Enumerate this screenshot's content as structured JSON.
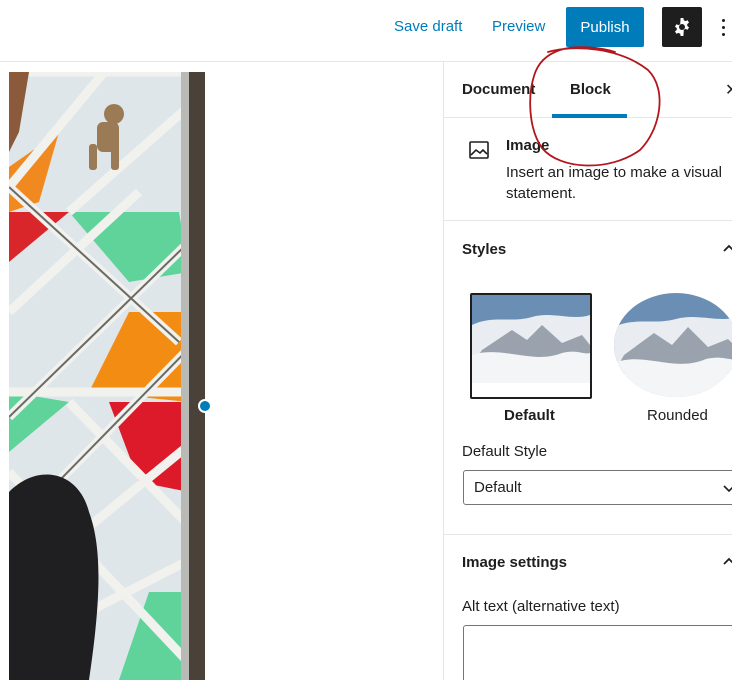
{
  "topbar": {
    "save_draft": "Save draft",
    "preview": "Preview",
    "publish": "Publish",
    "settings_icon": "gear-icon",
    "more_icon": "vertical-ellipsis-icon"
  },
  "sidebar": {
    "tabs": [
      {
        "label": "Document",
        "active": false
      },
      {
        "label": "Block",
        "active": true
      }
    ],
    "block_card": {
      "icon": "image-icon",
      "title": "Image",
      "description": "Insert an image to make a visual statement."
    },
    "styles": {
      "heading": "Styles",
      "options": [
        {
          "label": "Default",
          "selected": true
        },
        {
          "label": "Rounded",
          "selected": false
        }
      ]
    },
    "default_style": {
      "label": "Default Style",
      "value": "Default"
    },
    "image_settings": {
      "heading": "Image settings",
      "alt_label": "Alt text (alternative text)",
      "alt_value": ""
    }
  },
  "colors": {
    "accent": "#007cba",
    "annotation": "#b3161b",
    "dark": "#1e1e1e"
  }
}
